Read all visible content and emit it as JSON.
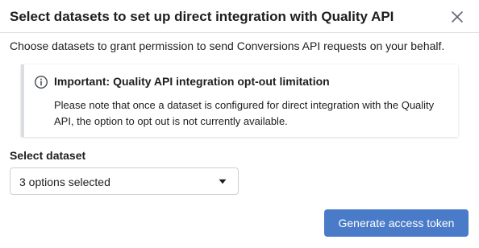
{
  "dialog": {
    "title": "Select datasets to set up direct integration with Quality API",
    "close_icon": "close-icon",
    "subtitle": "Choose datasets to grant permission to send Conversions API requests on your behalf."
  },
  "notice": {
    "icon": "info-icon",
    "title": "Important: Quality API integration opt-out limitation",
    "body": "Please note that once a dataset is configured for direct integration with the Quality API, the option to opt out is not currently available."
  },
  "dataset_select": {
    "label": "Select dataset",
    "value": "3 options selected",
    "caret_icon": "caret-down-icon"
  },
  "actions": {
    "primary_label": "Generate access token",
    "primary_color": "#4a7bc8"
  }
}
